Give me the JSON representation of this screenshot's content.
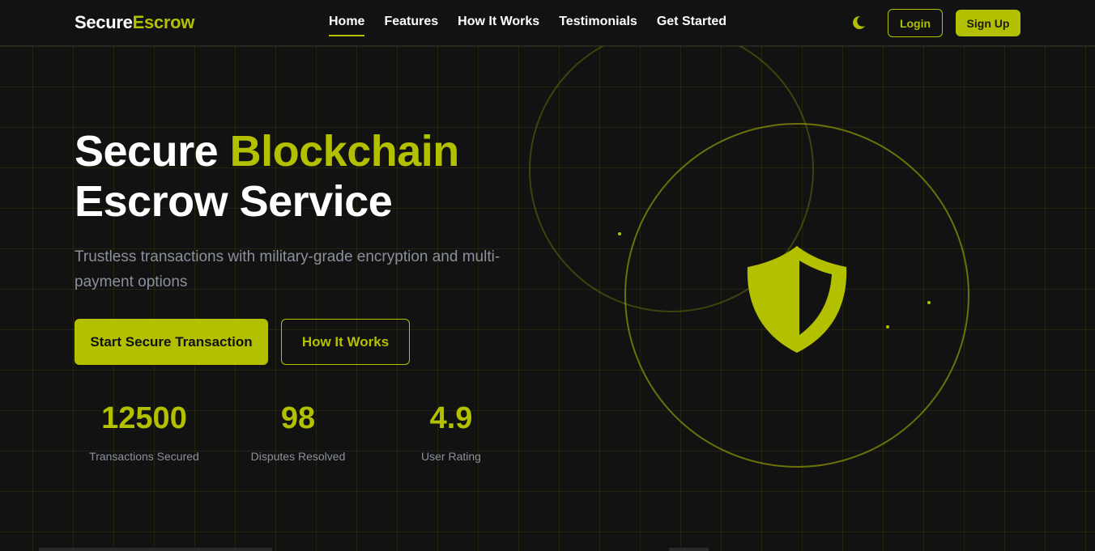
{
  "brand": {
    "part1": "Secure",
    "part2": "Escrow"
  },
  "nav": {
    "links": [
      {
        "label": "Home"
      },
      {
        "label": "Features"
      },
      {
        "label": "How It Works"
      },
      {
        "label": "Testimonials"
      },
      {
        "label": "Get Started"
      }
    ],
    "active": "Home",
    "login_label": "Login",
    "signup_label": "Sign Up"
  },
  "hero": {
    "title_part1": "Secure",
    "title_accent": "Blockchain",
    "title_line2": "Escrow Service",
    "subtitle": "Trustless transactions with military-grade encryption and multi-payment options",
    "primary_button": "Start Secure Transaction",
    "secondary_button": "How It Works"
  },
  "stats": [
    {
      "value": "12500",
      "label": "Transactions Secured"
    },
    {
      "value": "98",
      "label": "Disputes Resolved"
    },
    {
      "value": "4.9",
      "label": "User Rating"
    }
  ],
  "icons": {
    "theme_toggle": "moon-icon",
    "hero_graphic": "shield-icon"
  },
  "colors": {
    "accent": "#b3c000",
    "background": "#121212",
    "text_muted": "#8b909a"
  }
}
